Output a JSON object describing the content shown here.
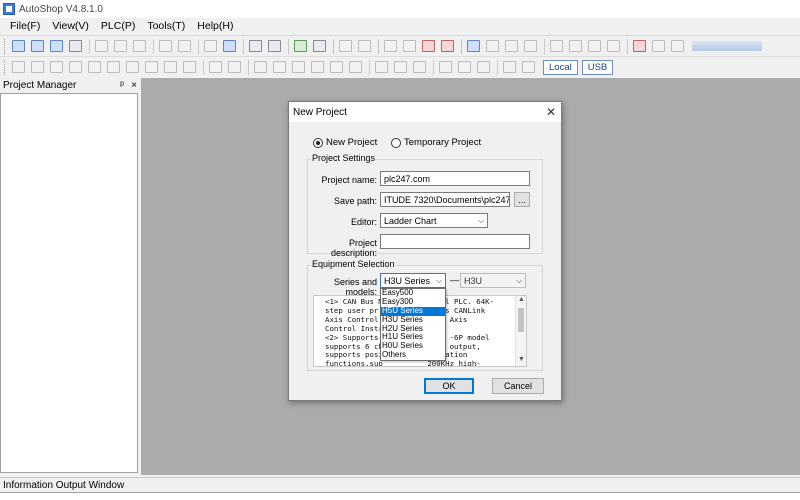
{
  "app": {
    "title": "AutoShop V4.8.1.0"
  },
  "menubar": [
    "File(F)",
    "View(V)",
    "PLC(P)",
    "Tools(T)",
    "Help(H)"
  ],
  "toolbar": {
    "local_label": "Local",
    "usb_label": "USB"
  },
  "project_manager": {
    "title": "Project Manager",
    "pin_glyph": "ᵖ",
    "close_glyph": "×"
  },
  "info_output": {
    "title": "Information Output Window"
  },
  "dialog": {
    "title": "New Project",
    "close_glyph": "✕",
    "radio_new": "New Project",
    "radio_temp": "Temporary Project",
    "project_settings": {
      "group_label": "Project Settings",
      "name_label": "Project name:",
      "name_value": "plc247.com",
      "path_label": "Save path:",
      "path_value": "ITUDE 7320\\Documents\\plc247.com\\",
      "browse_label": "...",
      "editor_label": "Editor:",
      "editor_value": "Ladder Chart",
      "desc_label": "Project description:",
      "desc_value": ""
    },
    "equipment": {
      "group_label": "Equipment Selection",
      "series_label": "Series and models:",
      "series_value": "H3U Series",
      "dash": "—",
      "model_value": "H3U",
      "description": "<1> CAN Bus M          Small PLC. 64K-\nstep user pr          5-axis CANLink\nAxis Control          NOpen Axis\nControl Instr\n<2> Supports          (only -6P model\nsupports 6 ch          ulse output,\nsupports posi          rpolation\nfunctions,sup          200KHz high-\nspeed input.",
      "dropdown_items": [
        "Easy500",
        "Easy300",
        "H5U Series",
        "H3U Series",
        "H2U Series",
        "H1U Series",
        "H0U Series",
        "Others"
      ],
      "dropdown_selected_index": 2
    },
    "ok_label": "OK",
    "cancel_label": "Cancel"
  }
}
